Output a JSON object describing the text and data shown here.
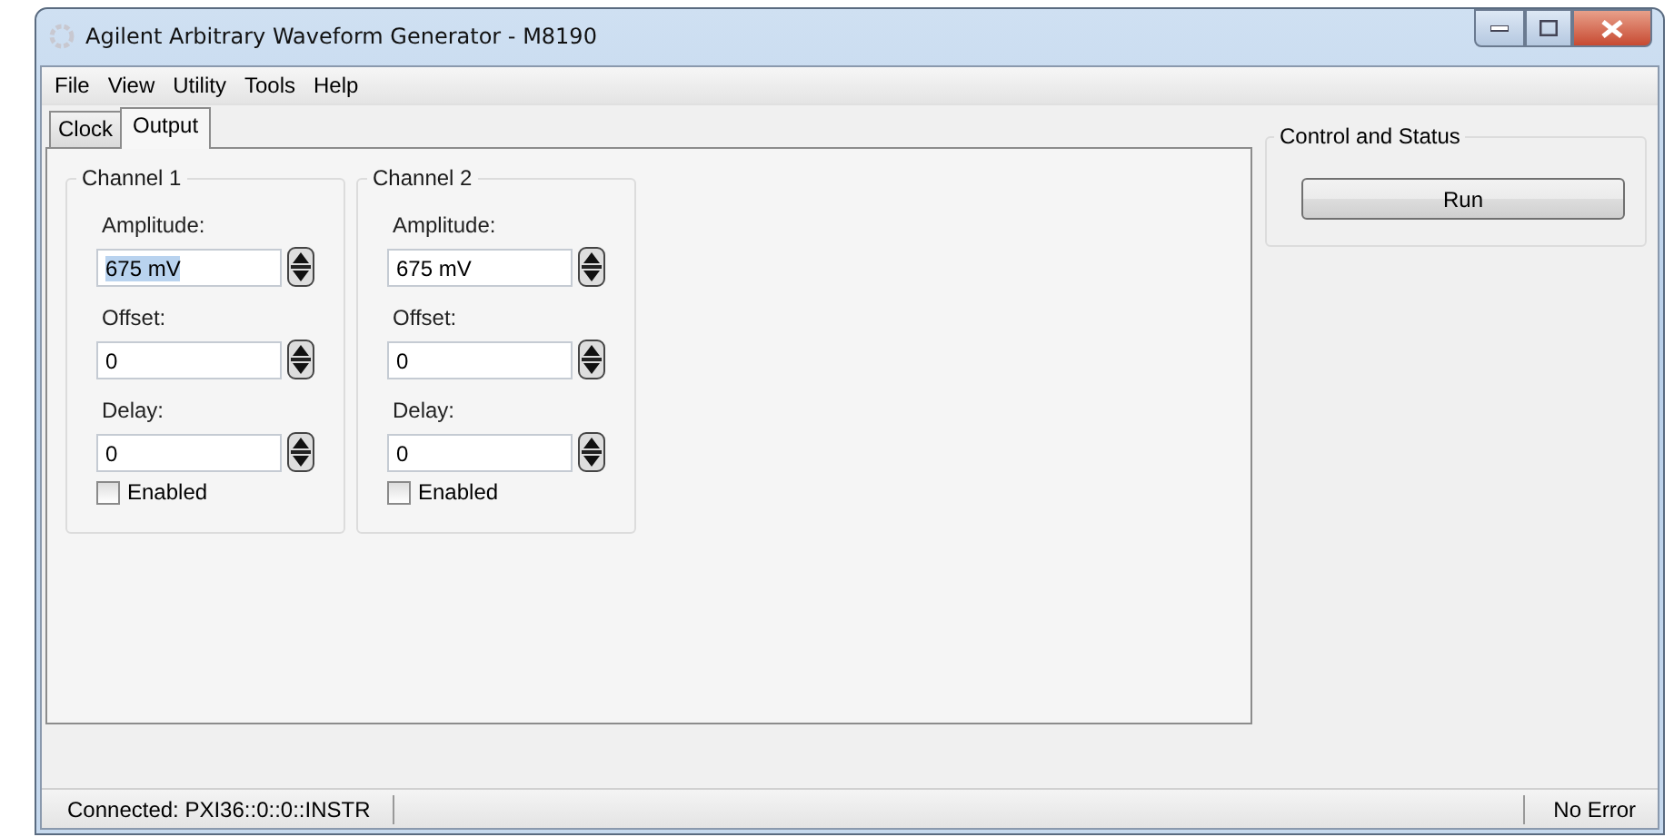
{
  "window": {
    "title": "Agilent Arbitrary Waveform Generator - M8190"
  },
  "menu": [
    "File",
    "View",
    "Utility",
    "Tools",
    "Help"
  ],
  "tabs": [
    {
      "label": "Clock",
      "selected": false
    },
    {
      "label": "Output",
      "selected": true
    }
  ],
  "channels": [
    {
      "title": "Channel 1",
      "fields": [
        {
          "label": "Amplitude:",
          "value": "675 mV",
          "text_selected": true
        },
        {
          "label": "Offset:",
          "value": "0",
          "text_selected": false
        },
        {
          "label": "Delay:",
          "value": "0",
          "text_selected": false
        }
      ],
      "enabled": {
        "label": "Enabled",
        "checked": false
      }
    },
    {
      "title": "Channel 2",
      "fields": [
        {
          "label": "Amplitude:",
          "value": "675 mV",
          "text_selected": false
        },
        {
          "label": "Offset:",
          "value": "0",
          "text_selected": false
        },
        {
          "label": "Delay:",
          "value": "0",
          "text_selected": false
        }
      ],
      "enabled": {
        "label": "Enabled",
        "checked": false
      }
    }
  ],
  "control": {
    "title": "Control and Status",
    "button": "Run"
  },
  "status_bar": {
    "connection": "Connected: PXI36::0::0::INSTR",
    "error": "No Error"
  }
}
